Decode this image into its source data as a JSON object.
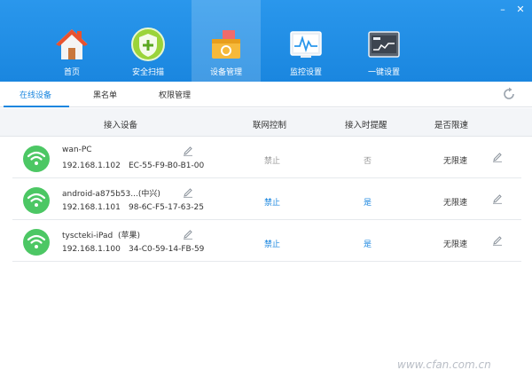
{
  "window": {
    "minimize": "–",
    "close": "✕"
  },
  "nav": [
    {
      "label": "首页",
      "icon": "home-icon"
    },
    {
      "label": "安全扫描",
      "icon": "shield-icon"
    },
    {
      "label": "设备管理",
      "icon": "toolbox-icon",
      "active": true
    },
    {
      "label": "监控设置",
      "icon": "monitor-icon"
    },
    {
      "label": "一键设置",
      "icon": "router-icon"
    }
  ],
  "tabs": [
    {
      "label": "在线设备",
      "active": true
    },
    {
      "label": "黑名单"
    },
    {
      "label": "权限管理"
    }
  ],
  "table": {
    "headers": [
      "接入设备",
      "联网控制",
      "接入时提醒",
      "是否限速"
    ],
    "rows": [
      {
        "name": "wan-PC",
        "ip": "192.168.1.102",
        "mac": "EC-55-F9-B0-B1-00",
        "net": "禁止",
        "net_enabled": false,
        "remind": "否",
        "remind_enabled": false,
        "speed": "无限速"
      },
      {
        "name": "android-a875b53...(中兴)",
        "ip": "192.168.1.101",
        "mac": "98-6C-F5-17-63-25",
        "net": "禁止",
        "net_enabled": true,
        "remind": "是",
        "remind_enabled": true,
        "speed": "无限速"
      },
      {
        "name": "tyscteki-iPad  (苹果)",
        "ip": "192.168.1.100",
        "mac": "34-C0-59-14-FB-59",
        "net": "禁止",
        "net_enabled": true,
        "remind": "是",
        "remind_enabled": true,
        "speed": "无限速"
      }
    ]
  },
  "watermark": "www.cfan.com.cn",
  "colors": {
    "accent": "#1a86df",
    "wifi_green": "#4cc764",
    "muted": "#999999"
  }
}
